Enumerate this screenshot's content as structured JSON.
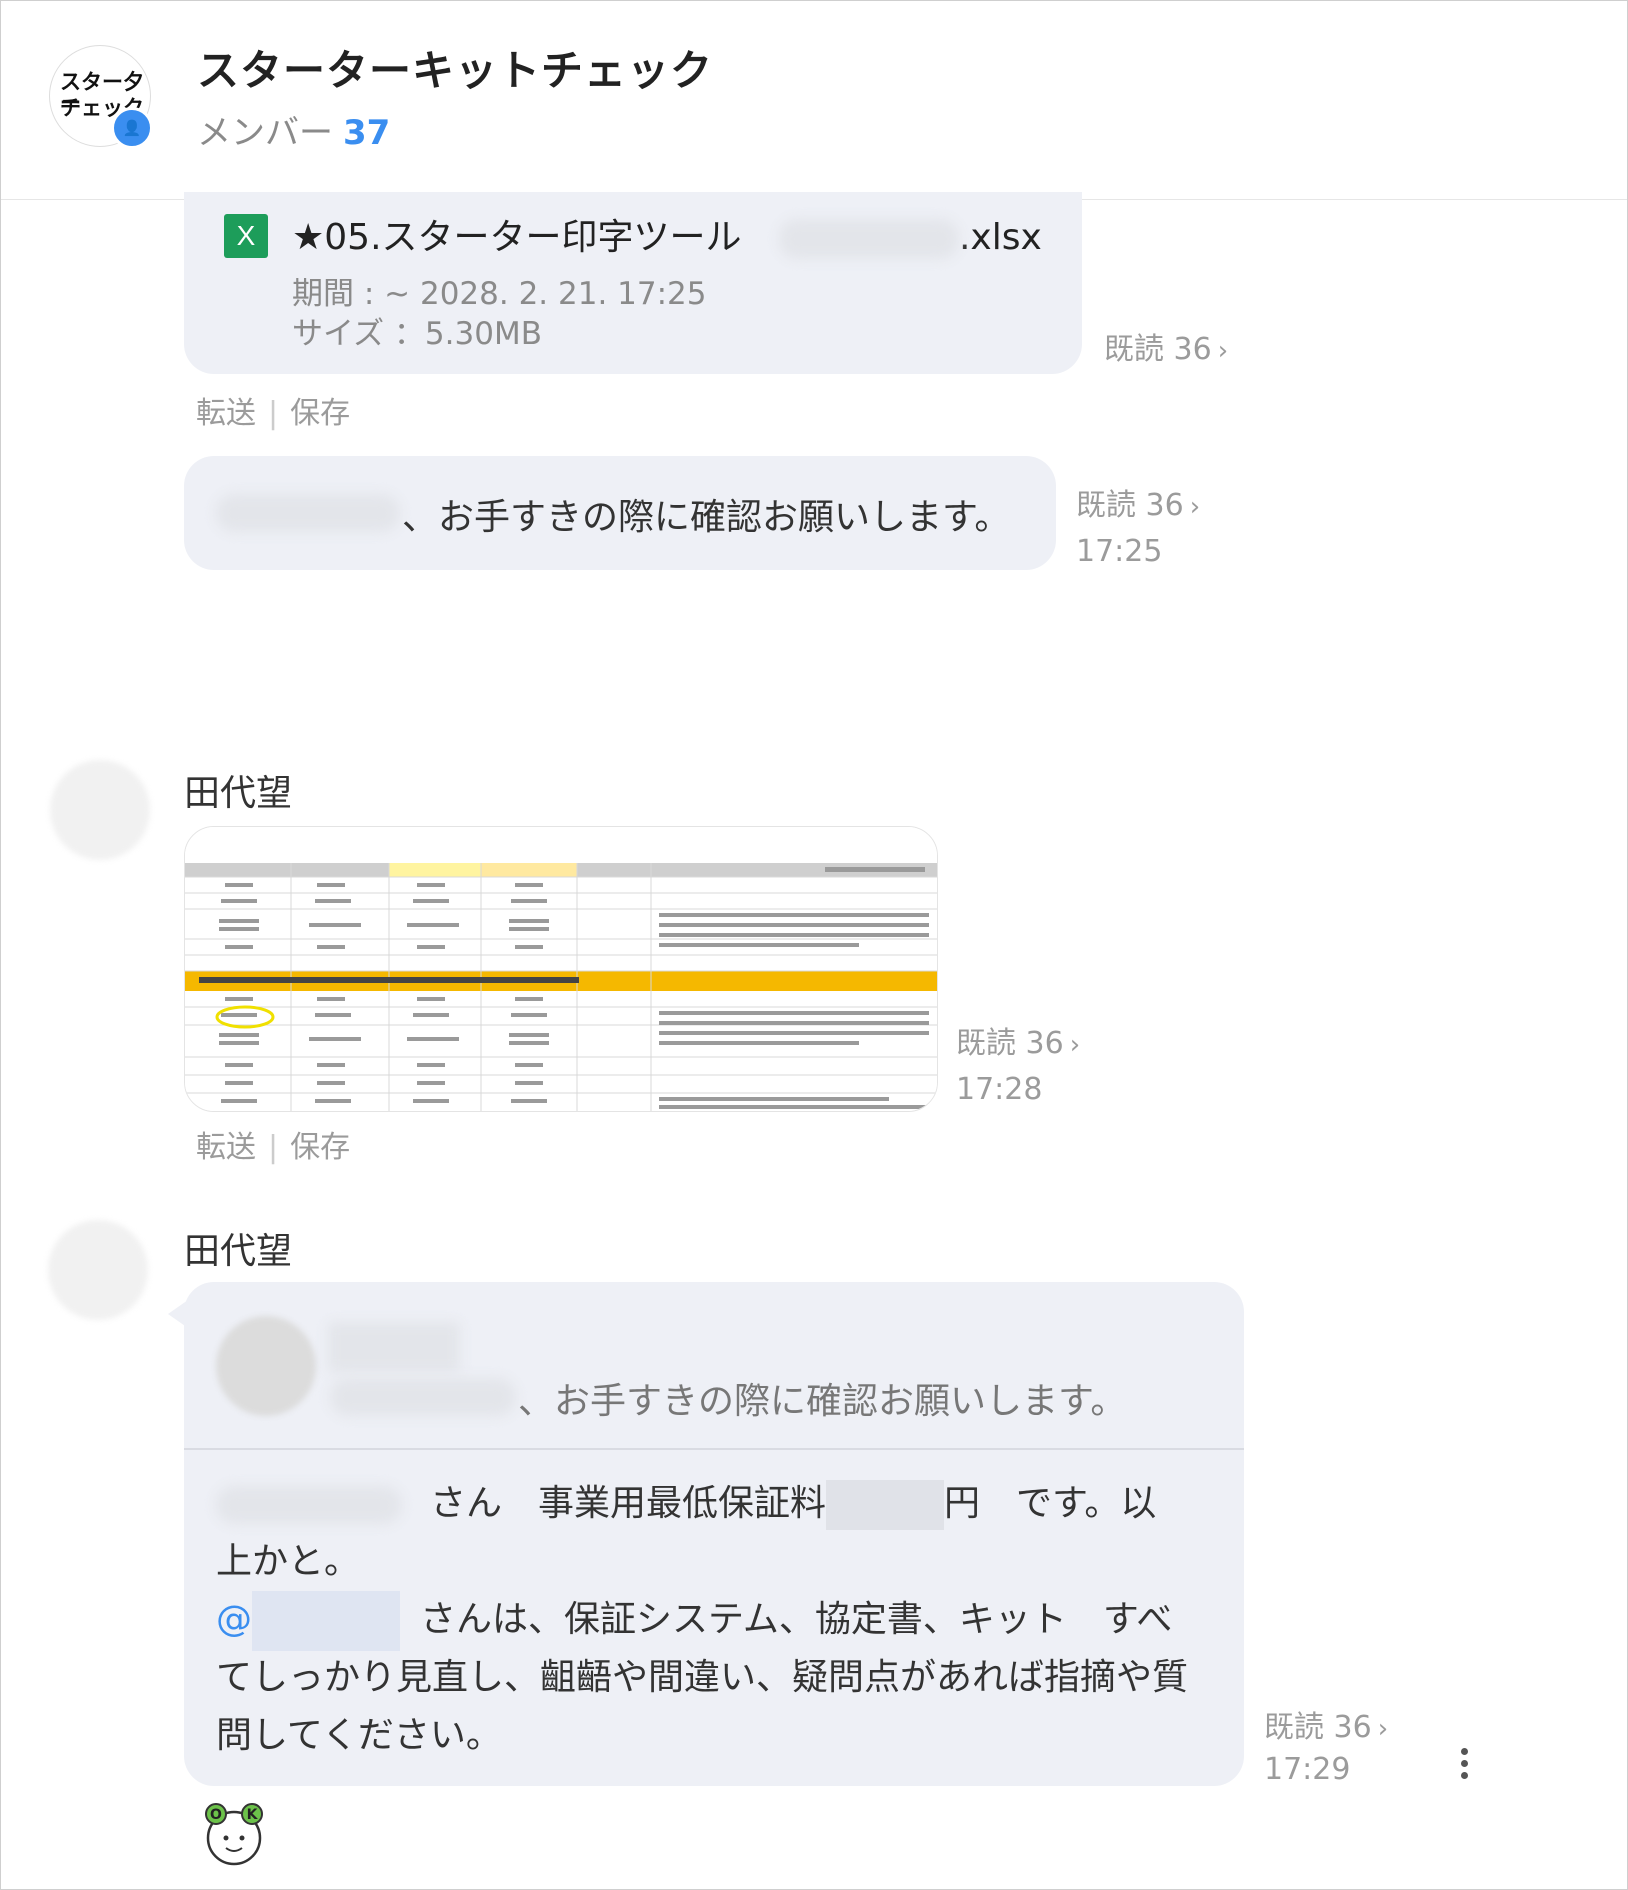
{
  "header": {
    "avatar_text_line1": "スター夕ー",
    "avatar_text_line2": "チェック",
    "title": "スターターキットチェック",
    "member_label": "メンバー",
    "member_count": "37"
  },
  "messages": [
    {
      "type": "file",
      "file_icon": "excel-icon",
      "file_icon_glyph": "X",
      "file_name": "★05.スターター印字ツール",
      "file_ext": ".xlsx",
      "period": "期間 : ~ 2028. 2. 21. 17:25",
      "size": "サイズ ：5.30MB",
      "read": "既読 36",
      "actions": [
        "転送",
        "保存"
      ]
    },
    {
      "type": "text",
      "text": "、お手すきの際に確認お願いします。",
      "read": "既読 36",
      "time": "17:25"
    },
    {
      "type": "image",
      "sender": "田代望",
      "read": "既読 36",
      "time": "17:28",
      "actions": [
        "転送",
        "保存"
      ]
    },
    {
      "type": "reply",
      "sender": "田代望",
      "quoted_text": "、お手すきの際に確認お願いします。",
      "line1_a": "さん　事業用最低保証料",
      "line1_b": "円　です。以",
      "line2": "上かと。",
      "mention_symbol": "@",
      "line3": "さんは、保証システム、協定書、キット　すべ",
      "line4": "てしっかり見直し、齟齬や間違い、疑問点があれば指摘や質",
      "line5": "問してください。",
      "read": "既読 36",
      "time": "17:29",
      "more_icon": "more-vertical-icon",
      "reaction": "ok-sticker"
    }
  ],
  "colors": {
    "accent": "#3a8ef0",
    "bubble": "#eef0f6",
    "meta": "#9b9b9b",
    "excel": "#1d9d5a",
    "sheet_highlight": "#f5b800"
  }
}
